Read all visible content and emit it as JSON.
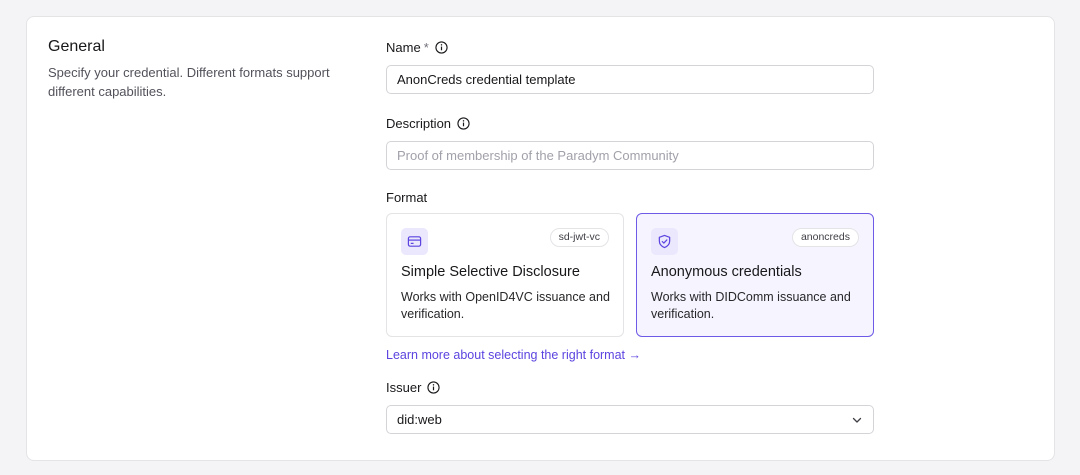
{
  "general": {
    "title": "General",
    "description": "Specify your credential. Different formats support different capabilities."
  },
  "name": {
    "label": "Name",
    "required_marker": "*",
    "value": "AnonCreds credential template"
  },
  "description": {
    "label": "Description",
    "placeholder": "Proof of membership of the Paradym Community",
    "value": ""
  },
  "format": {
    "label": "Format",
    "options": [
      {
        "badge": "sd-jwt-vc",
        "title": "Simple Selective Disclosure",
        "description": "Works with OpenID4VC issuance and verification.",
        "icon": "card-icon",
        "selected": false
      },
      {
        "badge": "anoncreds",
        "title": "Anonymous credentials",
        "description": "Works with DIDComm issuance and verification.",
        "icon": "shield-check-icon",
        "selected": true
      }
    ],
    "learn_more": "Learn more about selecting the right format →"
  },
  "issuer": {
    "label": "Issuer",
    "value": "did:web"
  },
  "colors": {
    "accent": "#6d5ae6",
    "link": "#5b44e0",
    "selected_bg": "#f6f5ff",
    "icon_bg": "#ebe8fd"
  }
}
